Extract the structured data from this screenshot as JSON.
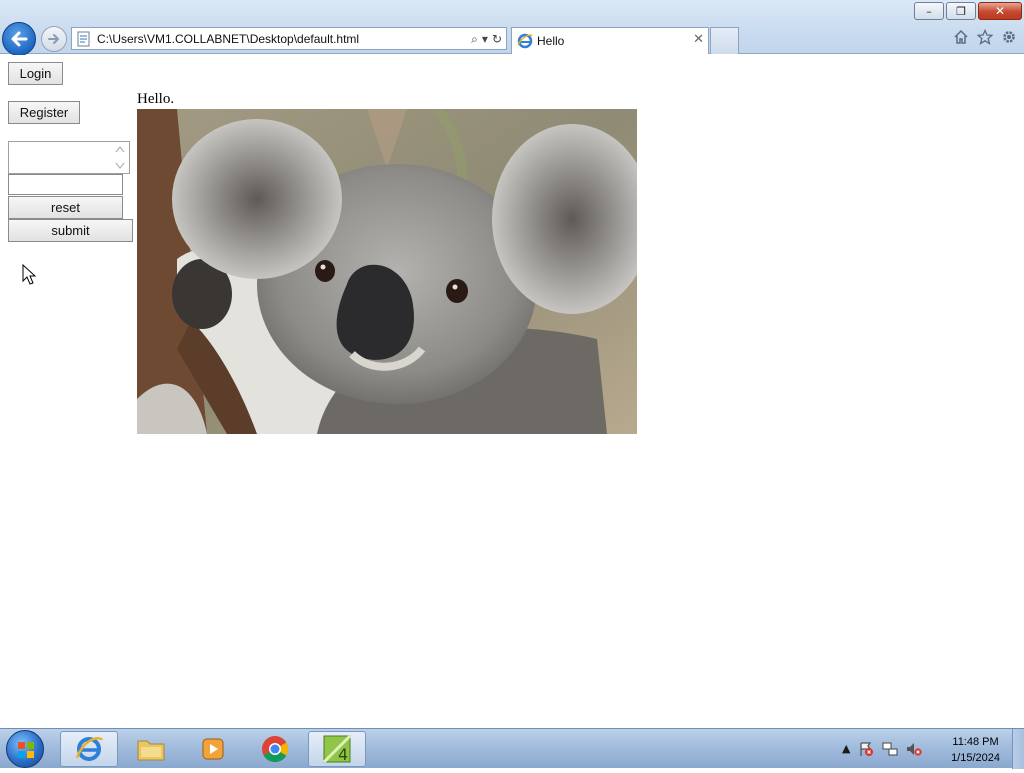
{
  "window": {
    "minimize_glyph": "–",
    "restore_glyph": "❐",
    "close_glyph": "✕"
  },
  "browser": {
    "address": "C:\\Users\\VM1.COLLABNET\\Desktop\\default.html",
    "address_icons": {
      "search": "⌕",
      "dropdown": "▾",
      "refresh": "↻"
    },
    "tab_title": "Hello",
    "tab_close_glyph": "✕",
    "toolbar_icons": [
      "home-icon",
      "favorites-star-icon",
      "tools-gear-icon"
    ]
  },
  "page": {
    "login_label": "Login",
    "register_label": "Register",
    "text_input_value": "",
    "textarea_value": "",
    "reset_label": "reset",
    "submit_label": "submit",
    "greeting": "Hello.",
    "image": "koala"
  },
  "taskbar": {
    "items": [
      "start-orb",
      "internet-explorer",
      "file-explorer",
      "media-player",
      "chrome",
      "app-4"
    ],
    "active_item": "internet-explorer",
    "tray_expand_glyph": "▲",
    "clock_time": "11:48 PM",
    "clock_date": "1/15/2024"
  },
  "colors": {
    "chrome_bg": "#c9dbef",
    "close_btn": "#c6492f",
    "back_btn": "#1f66c2",
    "taskbar_bg": "#9fbadb"
  }
}
